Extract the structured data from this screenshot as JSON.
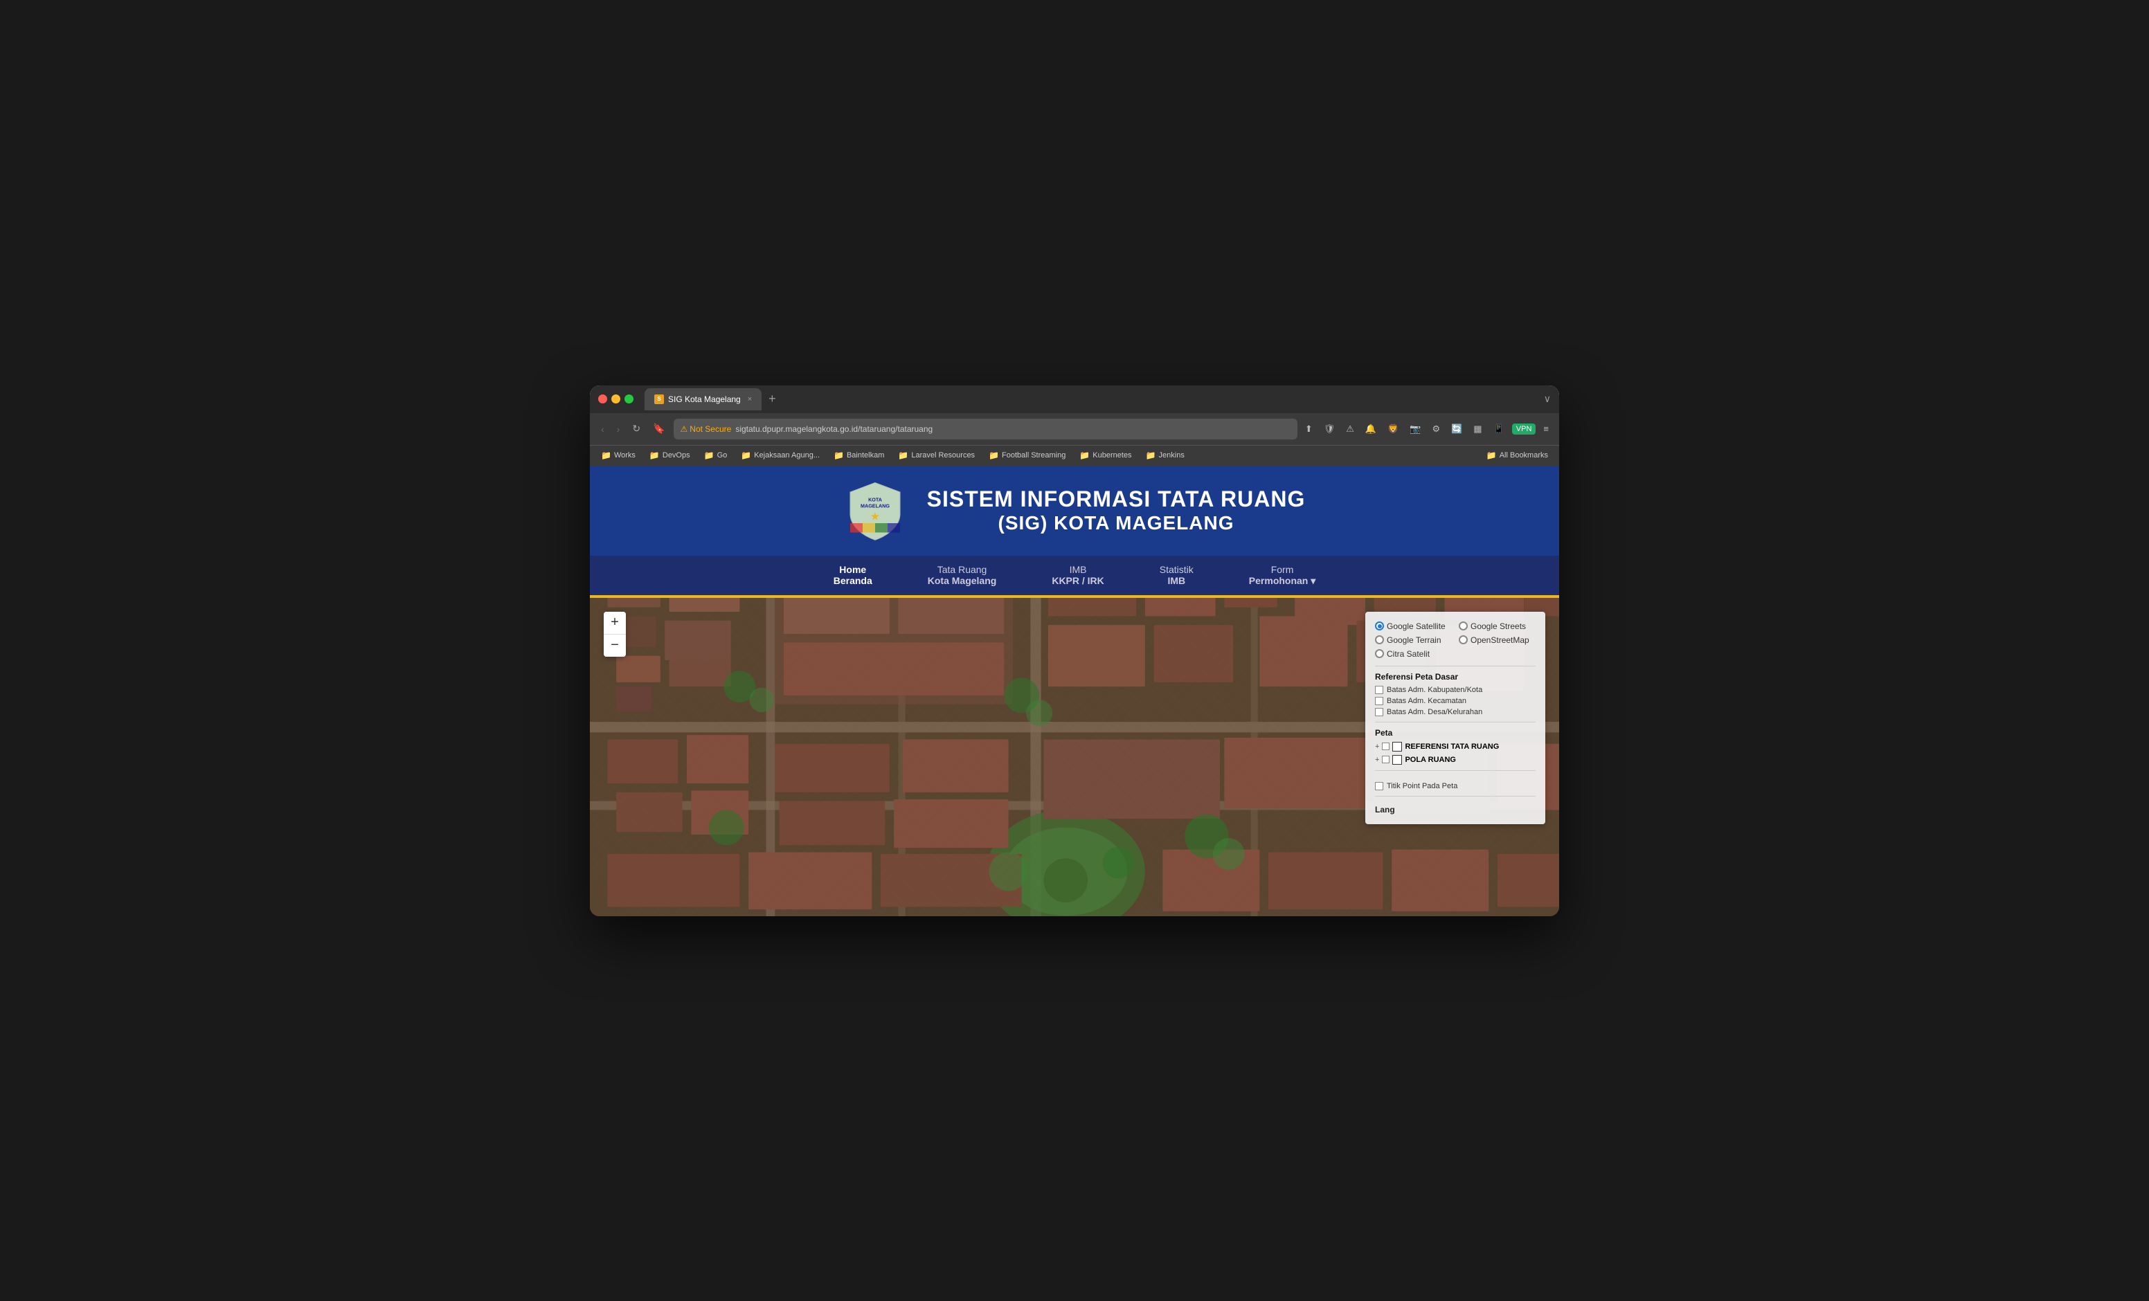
{
  "window": {
    "title": "SIG Kota Magelang",
    "tab_label": "SIG Kota Magelang",
    "close_btn": "×",
    "new_tab_btn": "+",
    "window_controls": "∨"
  },
  "navbar": {
    "back_btn": "‹",
    "forward_btn": "›",
    "reload_btn": "↻",
    "not_secure_label": "Not Secure",
    "url": "sigtatu.dpupr.magelangkota.go.id/tataruang/tataruang",
    "share_icon": "⬆",
    "vpn_label": "VPN",
    "menu_icon": "≡"
  },
  "bookmarks": {
    "items": [
      {
        "label": "Works"
      },
      {
        "label": "DevOps"
      },
      {
        "label": "Go"
      },
      {
        "label": "Kejaksaan Agung..."
      },
      {
        "label": "Baintelkam"
      },
      {
        "label": "Laravel Resources"
      },
      {
        "label": "Football Streaming"
      },
      {
        "label": "Kubernetes"
      },
      {
        "label": "Jenkins"
      }
    ],
    "all_label": "All Bookmarks"
  },
  "site_header": {
    "title_line1": "SISTEM INFORMASI TATA RUANG",
    "title_line2": "(SIG) KOTA MAGELANG"
  },
  "site_nav": {
    "items": [
      {
        "line1": "Home",
        "line2": "Beranda",
        "active": true
      },
      {
        "line1": "Tata Ruang",
        "line2": "Kota Magelang",
        "active": false
      },
      {
        "line1": "IMB",
        "line2": "KKPR / IRK",
        "active": false
      },
      {
        "line1": "Statistik",
        "line2": "IMB",
        "active": false
      },
      {
        "line1": "Form",
        "line2": "Permohonan ▾",
        "active": false
      }
    ]
  },
  "map_controls": {
    "zoom_in": "+",
    "zoom_out": "−"
  },
  "map_panel": {
    "layer_options": [
      {
        "label": "Google Satellite",
        "selected": true
      },
      {
        "label": "Google Streets",
        "selected": false
      },
      {
        "label": "Google Terrain",
        "selected": false
      },
      {
        "label": "OpenStreetMap",
        "selected": false
      },
      {
        "label": "Citra Satelit",
        "selected": false,
        "span": true
      }
    ],
    "referensi_title": "Referensi Peta Dasar",
    "referensi_items": [
      {
        "label": "Batas Adm. Kabupaten/Kota"
      },
      {
        "label": "Batas Adm. Kecamatan"
      },
      {
        "label": "Batas Adm. Desa/Kelurahan"
      }
    ],
    "peta_title": "Peta",
    "peta_items": [
      {
        "label": "REFERENSI TATA RUANG"
      },
      {
        "label": "POLA RUANG"
      }
    ],
    "titik_label": "Titik Point Pada Peta",
    "lang_label": "Lang"
  }
}
